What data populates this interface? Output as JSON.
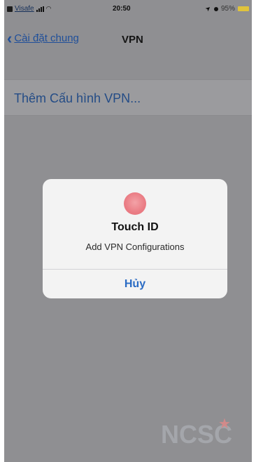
{
  "status_bar": {
    "carrier": "Visafe",
    "time": "20:50",
    "battery": "95%"
  },
  "nav": {
    "back_label": "Cài đặt chung",
    "title": "VPN"
  },
  "list": {
    "add_vpn_label": "Thêm Cấu hình VPN..."
  },
  "alert": {
    "title": "Touch ID",
    "message": "Add VPN Configurations",
    "cancel_label": "Hủy",
    "icon": "fingerprint-icon"
  },
  "watermark": {
    "logo_text": "NCSC",
    "badge": "VN"
  },
  "colors": {
    "accent": "#2a6bc4",
    "dim_background": "#8f8f92",
    "alert_background": "#f3f3f3",
    "touch_id": "#ea7c84"
  }
}
